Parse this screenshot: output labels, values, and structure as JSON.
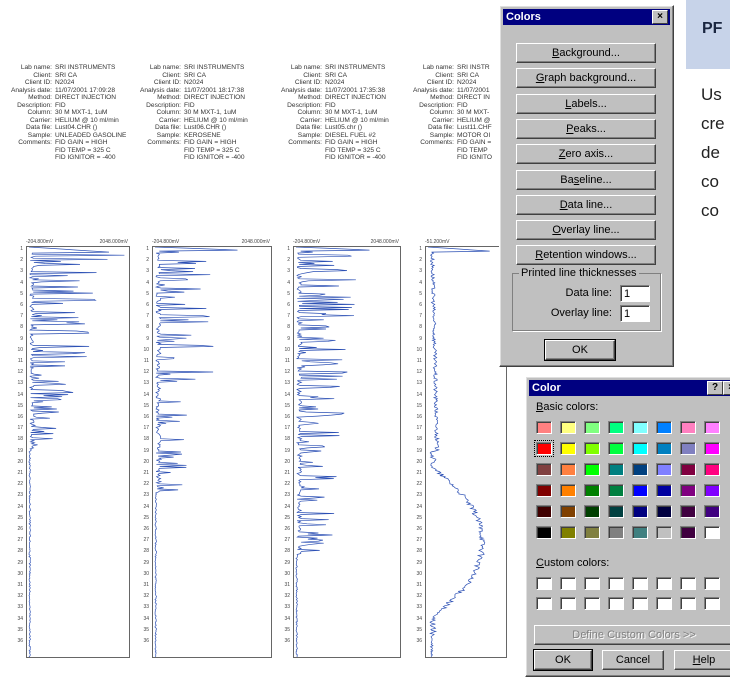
{
  "header_field_labels": [
    "Lab name:",
    "Client:",
    "Client ID:",
    "Analysis date:",
    "Method:",
    "Description:",
    "Column:",
    "Carrier:",
    "Data file:",
    "Sample:",
    "Comments:",
    "",
    ""
  ],
  "reports": [
    {
      "values": [
        "SRI INSTRUMENTS",
        "SRI CA",
        "N2024",
        "11/07/2001 17:09:28",
        "DIRECT INJECTION",
        "FID",
        "30 M MXT-1, 1uM",
        "HELIUM @ 10 ml/min",
        "Lust04.CHR ()",
        "UNLEADED GASOLINE",
        "FID GAIN = HIGH",
        "FID TEMP = 325 C",
        "FID IGNITOR = -400"
      ],
      "scale_min": "-204.800mV",
      "scale_max": "2048.000mV"
    },
    {
      "values": [
        "SRI INSTRUMENTS",
        "SRI CA",
        "N2024",
        "11/07/2001 18:17:38",
        "DIRECT INJECTION",
        "FID",
        "30 M MXT-1, 1uM",
        "HELIUM @ 10 ml/min",
        "Lust06.CHR ()",
        "KEROSENE",
        "FID GAIN = HIGH",
        "FID TEMP = 325 C",
        "FID IGNITOR = -400"
      ],
      "scale_min": "-204.800mV",
      "scale_max": "2048.000mV"
    },
    {
      "values": [
        "SRI INSTRUMENTS",
        "SRI CA",
        "N2024",
        "11/07/2001 17:35:38",
        "DIRECT INJECTION",
        "FID",
        "30 M MXT-1, 1uM",
        "HELIUM @ 10 ml/min",
        "Lust05.chr ()",
        "DIESEL FUEL #2",
        "FID GAIN = HIGH",
        "FID TEMP = 325 C",
        "FID IGNITOR = -400"
      ],
      "scale_min": "-204.800mV",
      "scale_max": "2048.000mV"
    },
    {
      "values": [
        "SRI INSTR",
        "SRI CA",
        "N2024",
        "11/07/2001",
        "DIRECT IN",
        "FID",
        "30 M MXT-",
        "HELIUM @",
        "Lust11.CHF",
        "MOTOR OI",
        "FID GAIN =",
        "FID TEMP",
        "FID IGNITO"
      ],
      "scale_min": "-51.200mV",
      "scale_max": ""
    }
  ],
  "time_ticks": [
    "1",
    "2",
    "3",
    "4",
    "5",
    "6",
    "7",
    "8",
    "9",
    "10",
    "11",
    "12",
    "13",
    "14",
    "15",
    "16",
    "17",
    "18",
    "19",
    "20",
    "21",
    "22",
    "23",
    "24",
    "25",
    "26",
    "27",
    "28",
    "29",
    "30",
    "31",
    "32",
    "33",
    "34",
    "35",
    "36"
  ],
  "colors_dialog": {
    "title": "Colors",
    "close_glyph": "×",
    "buttons": [
      {
        "pre": "",
        "key": "B",
        "post": "ackground..."
      },
      {
        "pre": "",
        "key": "G",
        "post": "raph background..."
      },
      {
        "pre": "",
        "key": "L",
        "post": "abels..."
      },
      {
        "pre": "",
        "key": "P",
        "post": "eaks..."
      },
      {
        "pre": "",
        "key": "Z",
        "post": "ero axis..."
      },
      {
        "pre": "Ba",
        "key": "s",
        "post": "eline..."
      },
      {
        "pre": "",
        "key": "D",
        "post": "ata line..."
      },
      {
        "pre": "",
        "key": "O",
        "post": "verlay line..."
      },
      {
        "pre": "",
        "key": "R",
        "post": "etention windows..."
      }
    ],
    "group_label": "Printed line thicknesses",
    "data_line_label": "Data line:",
    "data_line_value": "1",
    "overlay_line_label": "Overlay line:",
    "overlay_line_value": "1",
    "ok_label": "OK"
  },
  "color_dialog": {
    "title": "Color",
    "help_glyph": "?",
    "close_glyph": "×",
    "basic_label": "Basic colors:",
    "custom_label": "Custom colors:",
    "define_label": "Define Custom Colors >>",
    "ok_label": "OK",
    "cancel_label": "Cancel",
    "help_label": "Help",
    "basic_colors": [
      "#ff8080",
      "#ffff80",
      "#80ff80",
      "#00ff80",
      "#80ffff",
      "#0080ff",
      "#ff80c0",
      "#ff80ff",
      "#ff0000",
      "#ffff00",
      "#80ff00",
      "#00ff40",
      "#00ffff",
      "#0080c0",
      "#8080c0",
      "#ff00ff",
      "#804040",
      "#ff8040",
      "#00ff00",
      "#008080",
      "#004080",
      "#8080ff",
      "#800040",
      "#ff0080",
      "#800000",
      "#ff8000",
      "#008000",
      "#008040",
      "#0000ff",
      "#0000a0",
      "#800080",
      "#8000ff",
      "#400000",
      "#804000",
      "#004000",
      "#004040",
      "#000080",
      "#000040",
      "#400040",
      "#400080",
      "#000000",
      "#808000",
      "#808040",
      "#808080",
      "#408080",
      "#c0c0c0",
      "#400040",
      "#ffffff"
    ],
    "selected_index": 8
  },
  "side_panel": {
    "heading": "PF",
    "lines": [
      "Us",
      "cre",
      "de",
      "co",
      "co"
    ]
  }
}
